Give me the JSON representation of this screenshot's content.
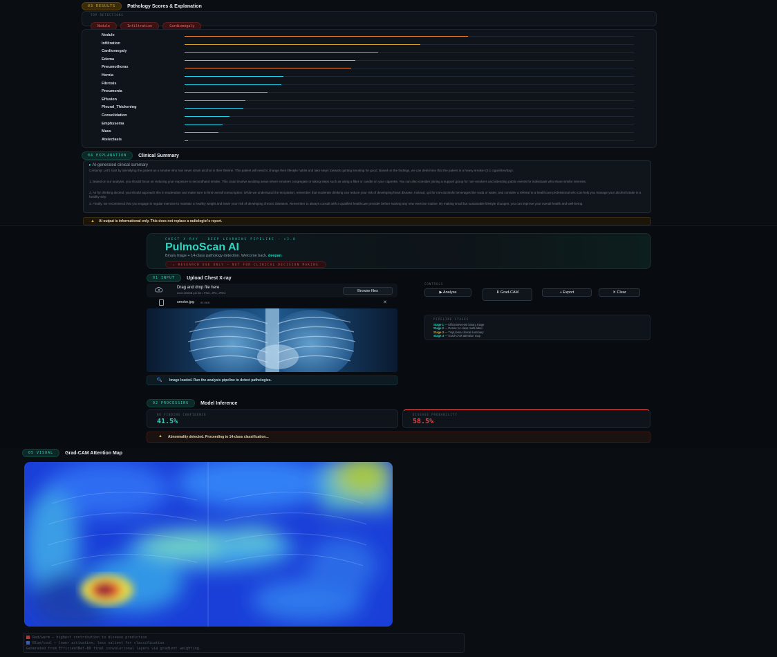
{
  "results": {
    "tag": "03 RESULTS",
    "title": "Pathology Scores & Explanation",
    "detected_label": "TOP DETECTIONS",
    "chips": [
      "Nodule",
      "Infiltration",
      "Cardiomegaly"
    ],
    "pathologies": [
      {
        "name": "Nodule",
        "pct": 0.63,
        "color": "#ef8a3a"
      },
      {
        "name": "Infiltration",
        "pct": 0.525,
        "color": "#e0a826"
      },
      {
        "name": "Cardiomegaly",
        "pct": 0.43,
        "color": "#ef8a3a"
      },
      {
        "name": "Edema",
        "pct": 0.38,
        "color": "#e0a826"
      },
      {
        "name": "Pneumothorax",
        "pct": 0.37,
        "color": "#ef8a3a"
      },
      {
        "name": "Hernia",
        "pct": 0.22,
        "color": "#22d3ee"
      },
      {
        "name": "Fibrosis",
        "pct": 0.215,
        "color": "#22d3ee"
      },
      {
        "name": "Pneumonia",
        "pct": 0.185,
        "color": "#22d3ee"
      },
      {
        "name": "Effusion",
        "pct": 0.135,
        "color": "#22d3ee"
      },
      {
        "name": "Pleural_Thickening",
        "pct": 0.13,
        "color": "#22d3ee"
      },
      {
        "name": "Consolidation",
        "pct": 0.1,
        "color": "#22d3ee"
      },
      {
        "name": "Emphysema",
        "pct": 0.085,
        "color": "#22d3ee"
      },
      {
        "name": "Mass",
        "pct": 0.075,
        "color": "#22d3ee"
      },
      {
        "name": "Atelectasis",
        "pct": 0.008,
        "color": "#22d3ee"
      }
    ],
    "explanation_tag": "04 EXPLANATION",
    "explanation_title": "Clinical Summary",
    "summary_head": "AI-generated clinical summary",
    "summary_paragraphs": [
      "Certainly! Let's start by identifying the patient as a smoker who has never drank alcohol in their lifetime. This patient will need to change their lifestyle habits and take steps towards quitting smoking for good. Based on the findings, we can determine that the patient is a heavy smoker (0.1 cigarettes/day).",
      "1. Based on our analysis, you should focus on reducing your exposure to secondhand smoke. This could involve avoiding areas where smokers congregate or taking steps such as using a filter or candle on your cigarette. You can also consider joining a support group for non-smokers and attending public events for individuals who share similar interests.",
      "2. As for drinking alcohol, you should approach this in moderation and make sure to limit overall consumption. While we understand the temptation, remember that moderate drinking can reduce your risk of developing heart disease. Instead, opt for non-alcoholic beverages like soda or water, and consider a referral to a healthcare professional who can help you manage your alcohol intake in a healthy way.",
      "3. Finally, we recommend that you engage in regular exercise to maintain a healthy weight and lower your risk of developing chronic diseases. Remember to always consult with a qualified healthcare provider before starting any new exercise routine. By making small but sustainable lifestyle changes, you can improve your overall health and well-being."
    ],
    "disclaimer": "AI output is informational only. This does not replace a radiologist's report."
  },
  "app": {
    "kicker": "CHEST X-RAY · DEEP LEARNING PIPELINE · v2.0",
    "title": "PulmoScan AI",
    "subtitle_prefix": "Binary triage + 14-class pathology detection. Welcome back,",
    "username": "deepan",
    "badge": "⚠ RESEARCH USE ONLY — NOT FOR CLINICAL DECISION MAKING",
    "upload_tag": "01 INPUT",
    "upload_title": "Upload Chest X-ray",
    "drop_title": "Drag and drop file here",
    "drop_sub": "Limit 200MB per file • PNG, JPG, JPEG",
    "browse_label": "Browse files",
    "file_name": "smoke.jpg",
    "file_size": "92.9KB",
    "loaded_msg": "Image loaded. Run the analysis pipeline to detect pathologies.",
    "controls_label": "CONTROLS",
    "buttons": {
      "analyse": "▶ Analyse",
      "gradcam": "⬇ Grad-CAM",
      "export": "+ Export",
      "clear": "✕ Clear"
    },
    "pipeline_title": "PIPELINE STAGES",
    "stages": [
      {
        "stage": "Stage 1",
        "text": "EfficientNet-B0 binary triage",
        "color": "#2dd4bf"
      },
      {
        "stage": "Stage 2",
        "text": "Dense 14-class multi-label",
        "color": "#2dd4bf"
      },
      {
        "stage": "Stage 3",
        "text": "TinyLlama clinical summary",
        "color": "#e0a826"
      },
      {
        "stage": "Stage 4",
        "text": "Grad-CAM attention map",
        "color": "#2dd4bf"
      }
    ],
    "proc_tag": "02 PROCESSING",
    "proc_title": "Model Inference",
    "normal_label": "NO FINDING CONFIDENCE",
    "normal_value": "41.5%",
    "disease_label": "DISEASE PROBABILITY",
    "disease_value": "58.5%",
    "abnormal_msg": "Abnormality detected. Proceeding to 14-class classification..."
  },
  "gradcam": {
    "tag": "05 VISUAL",
    "title": "Grad-CAM Attention Map",
    "legend": [
      "Red/warm — highest contribution to disease prediction",
      "Blue/cool — lower activation, less salient for classification",
      "Generated from EfficientNet-B0 final convolutional layers via gradient weighting."
    ]
  }
}
